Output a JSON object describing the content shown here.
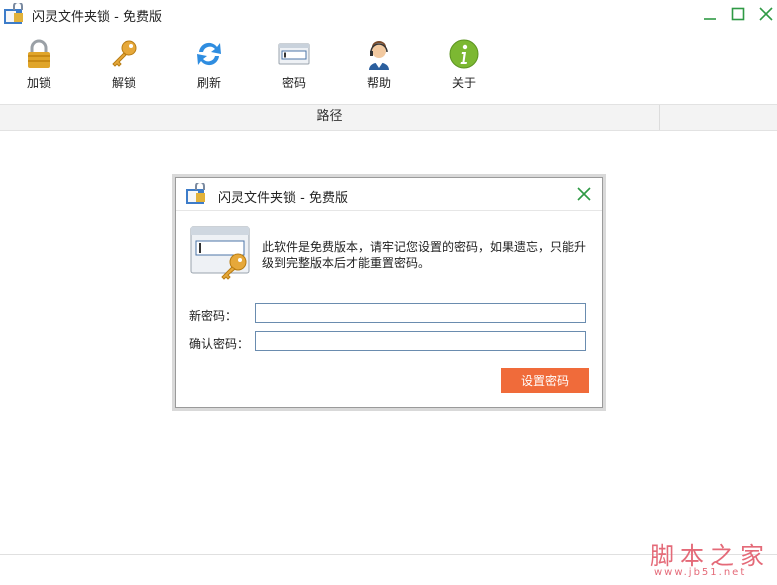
{
  "window": {
    "title": "闪灵文件夹锁 - 免费版",
    "minimize_glyph": "—",
    "maximize_glyph": "□",
    "close_glyph": "✕",
    "accent_color": "#2f9a45"
  },
  "toolbar": {
    "items": [
      {
        "label": "加锁",
        "icon": "padlock-icon"
      },
      {
        "label": "解锁",
        "icon": "key-icon"
      },
      {
        "label": "刷新",
        "icon": "refresh-icon"
      },
      {
        "label": "密码",
        "icon": "password-icon"
      },
      {
        "label": "帮助",
        "icon": "support-agent-icon"
      },
      {
        "label": "关于",
        "icon": "info-icon"
      }
    ]
  },
  "list": {
    "columns": [
      "路径",
      ""
    ]
  },
  "dialog": {
    "title": "闪灵文件夹锁 - 免费版",
    "message": "此软件是免费版本，请牢记您设置的密码，如果遗忘，只能升级到完整版本后才能重置密码。",
    "new_password_label": "新密码：",
    "confirm_password_label": "确认密码：",
    "new_password_value": "",
    "confirm_password_value": "",
    "submit_label": "设置密码",
    "button_color": "#f06b3a"
  },
  "watermark": {
    "text": "脚本之家",
    "url": "www.jb51.net"
  }
}
